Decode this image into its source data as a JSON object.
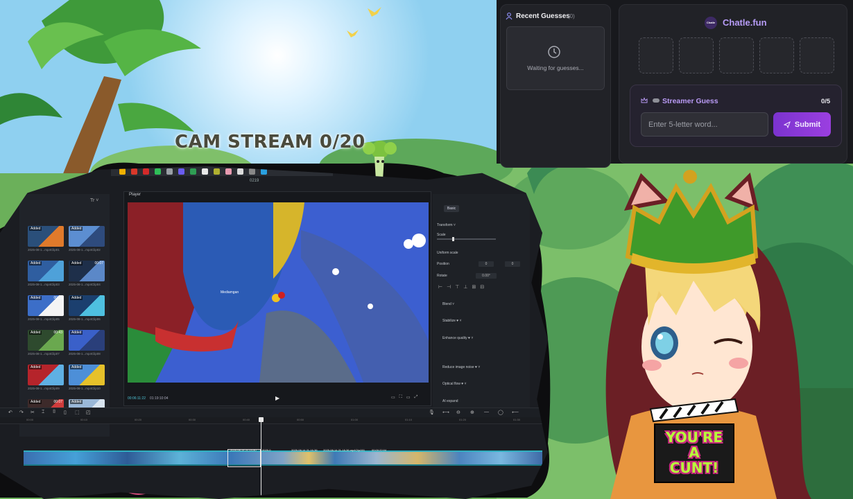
{
  "stream": {
    "cam_title": "CAM STREAM 0/20"
  },
  "editor": {
    "window_title": "0219",
    "media_tools": "Tr ˅",
    "thumbnails": [
      {
        "tag": "Added",
        "duration": "",
        "name": "2025-08-1...mp4Clip01",
        "c1": "#2a4f7a",
        "c2": "#e07a2b"
      },
      {
        "tag": "Added",
        "duration": "",
        "name": "2025-08-1...mp4Clip02",
        "c1": "#5c8ed1",
        "c2": "#2e4b7d"
      },
      {
        "tag": "Added",
        "duration": "",
        "name": "2025-08-1...mp4Clip03",
        "c1": "#2f5ea0",
        "c2": "#4ea1d9"
      },
      {
        "tag": "Added",
        "duration": "00:07",
        "name": "2025-08-1...mp4Clip04",
        "c1": "#1e2f4a",
        "c2": "#5b88c8"
      },
      {
        "tag": "Added",
        "duration": "00:29",
        "name": "2025-08-1...mp4Clip05",
        "c1": "#3c6ec8",
        "c2": "#f4f4f4"
      },
      {
        "tag": "Added",
        "duration": "",
        "name": "2025-08-1...mp4Clip06",
        "c1": "#1b3f6e",
        "c2": "#4ec0e0"
      },
      {
        "tag": "Added",
        "duration": "00:43",
        "name": "2025-08-1...mp4Clip07",
        "c1": "#2e4a2e",
        "c2": "#6aa84f"
      },
      {
        "tag": "Added",
        "duration": "",
        "name": "2025-08-1...mp4Clip08",
        "c1": "#3a60c9",
        "c2": "#2a3f7a"
      },
      {
        "tag": "Added",
        "duration": "",
        "name": "2025-08-1...mp4Clip09",
        "c1": "#b5242b",
        "c2": "#5fb0e3"
      },
      {
        "tag": "Added",
        "duration": "",
        "name": "2025-08-1...mp4Clip10",
        "c1": "#4d8fd8",
        "c2": "#e6c12a"
      },
      {
        "tag": "Added",
        "duration": "00:07",
        "name": "",
        "c1": "#3d2a2a",
        "c2": "#cf3b3b"
      },
      {
        "tag": "Added",
        "duration": "",
        "name": "",
        "c1": "#9ab8d8",
        "c2": "#d8e4f0"
      }
    ],
    "player_label": "Player",
    "player_caption": "Mediamgan",
    "time_current": "00:06:11:22",
    "time_total": "01:19:10:04",
    "play_glyph": "▶",
    "player_icons": [
      "▭",
      "⛶",
      "▭",
      "⤢"
    ],
    "props": {
      "tab_basic": "Basic",
      "transform": "Transform ˅",
      "scale": "Scale",
      "uniform_scale": "Uniform scale",
      "position": "Position",
      "pos_x": "0",
      "pos_y": "0",
      "rotate": "Rotate",
      "rotate_val": "0.00°",
      "blend": "Blend ˅",
      "stabilize": "Stabilize ♥ ˅",
      "enhance": "Enhance quality ♥ ˅",
      "reduce_noise": "Reduce image noise ♥ ˅",
      "optical_flow": "Optical flow ♥ ˅",
      "ai_expand": "AI expand"
    },
    "timeline_tools_left": [
      "↶",
      "↷",
      "✂",
      "⌶",
      "⌷",
      "▯",
      "⬚",
      "◰"
    ],
    "timeline_tools_right": [
      "🎙",
      "⟷",
      "⊖",
      "⊕",
      "—",
      "◯",
      "⟵"
    ],
    "ruler_ticks": [
      "00:00",
      "00:10",
      "00:20",
      "00:30",
      "00:40",
      "00:50",
      "01:00",
      "01:10",
      "01:20",
      "01:30"
    ],
    "track_labels": [
      "2025-08-14 21-14-50",
      "2025-0",
      "2025-08-14 21-16-36",
      "2025-08-14 21-18-36.mp4Clip001",
      "00:00:22:04"
    ]
  },
  "chatle": {
    "recent_title": "Recent Guesses",
    "recent_count": "(0)",
    "waiting_text": "Waiting for guesses...",
    "brand": "Chatle.fun",
    "brand_logo_text": "Chatle",
    "letter_slots": [
      "",
      "",
      "",
      "",
      ""
    ],
    "guess_title": "Streamer Guess",
    "guess_count": "0/5",
    "input_placeholder": "Enter 5-letter word...",
    "submit_label": "Submit",
    "accent": "#9b3fe0",
    "brand_color": "#b79cf7"
  },
  "avatar": {
    "sign_text": "YOU'RE\nA\nCUNT!"
  }
}
